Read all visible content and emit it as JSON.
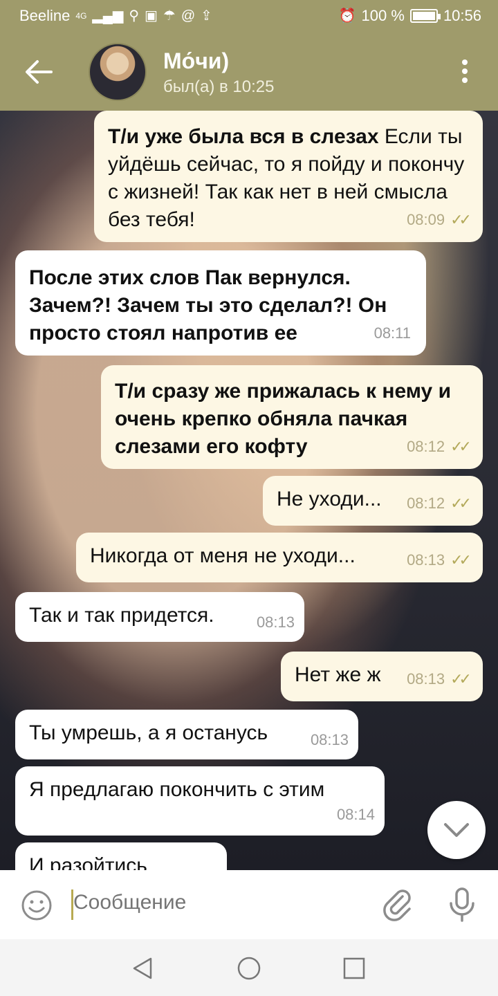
{
  "status_bar": {
    "carrier": "Beeline",
    "network": "4G",
    "battery": "100 %",
    "battery_level": 1.0,
    "time": "10:56"
  },
  "header": {
    "title": "Мо́чи)",
    "last_seen": "был(а) в 10:25"
  },
  "messages": [
    {
      "dir": "out",
      "bold": "Т/и уже была вся в слезах",
      "text": " Если ты уйдёшь сейчас, то я пойду и покончу с жизней!  Так как нет в ней смысла без тебя!",
      "time": "08:09",
      "read": true
    },
    {
      "dir": "in",
      "bold": "После этих слов Пак вернулся. Зачем?! Зачем ты это сделал?! Он просто стоял напротив ее",
      "text": "",
      "time": "08:11"
    },
    {
      "dir": "out",
      "bold": "Т/и сразу же прижалась к нему и очень крепко обняла пачкая слезами его кофту",
      "text": "",
      "time": "08:12",
      "read": true
    },
    {
      "dir": "out",
      "bold": "",
      "text": "Не уходи...",
      "time": "08:12",
      "read": true
    },
    {
      "dir": "out",
      "bold": "",
      "text": "Никогда от меня не уходи...",
      "time": "08:13",
      "read": true
    },
    {
      "dir": "in",
      "bold": "",
      "text": "Так и так придется.",
      "time": "08:13"
    },
    {
      "dir": "out",
      "bold": "",
      "text": "Нет же ж",
      "time": "08:13",
      "read": true
    },
    {
      "dir": "in",
      "bold": "",
      "text": "Ты умрешь, а я останусь",
      "time": "08:13"
    },
    {
      "dir": "in",
      "bold": "",
      "text": "Я предлагаю покончить с этим",
      "time": "08:14"
    },
    {
      "dir": "in",
      "bold": "",
      "text": "И разойтись",
      "time": ""
    }
  ],
  "input": {
    "placeholder": "Сообщение"
  },
  "colors": {
    "header": "#9f9b6b",
    "bubble_out": "#fdf7e4",
    "bubble_in": "#ffffff",
    "ticks": "#b3a95a"
  },
  "icons": [
    "back-arrow-icon",
    "more-vert-icon",
    "scroll-down-icon",
    "emoji-icon",
    "attach-icon",
    "mic-icon",
    "nav-back-icon",
    "nav-home-icon",
    "nav-recents-icon"
  ]
}
